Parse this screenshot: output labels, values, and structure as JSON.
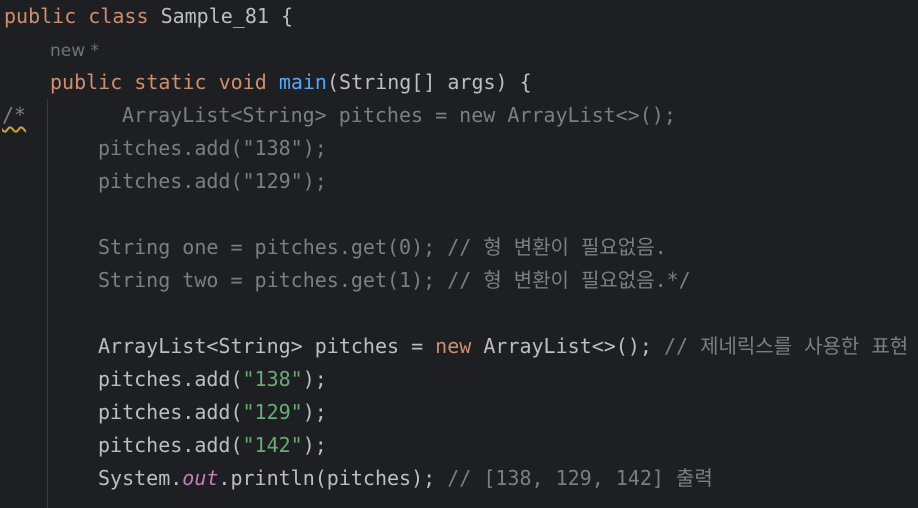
{
  "code": {
    "line1": {
      "kw1": "public",
      "kw2": "class",
      "name": "Sample_81",
      "brace": "{"
    },
    "inlay_hint": "new *",
    "line3": {
      "kw1": "public",
      "kw2": "static",
      "kw3": "void",
      "method": "main",
      "params": "(String[] args) {"
    },
    "comment_marker": "/*",
    "commented": [
      "ArrayList<String> pitches = new ArrayList<>();",
      "pitches.add(\"138\");",
      "pitches.add(\"129\");",
      "String one = pitches.get(0); // 형 변환이 필요없음.",
      "String two = pitches.get(1); // 형 변환이 필요없음.*/"
    ],
    "line10": {
      "type": "ArrayList<String> pitches = ",
      "kw": "new",
      "rest": " ArrayList<>();",
      "comment": "// 제네릭스를 사용한 표현"
    },
    "adds": [
      {
        "prefix": "pitches.add(",
        "arg": "\"138\"",
        "suffix": ");"
      },
      {
        "prefix": "pitches.add(",
        "arg": "\"129\"",
        "suffix": ");"
      },
      {
        "prefix": "pitches.add(",
        "arg": "\"142\"",
        "suffix": ");"
      }
    ],
    "println": {
      "prefix": "System.",
      "field": "out",
      "rest": ".println(pitches); ",
      "comment": "// [138, 129, 142] 출력"
    }
  }
}
